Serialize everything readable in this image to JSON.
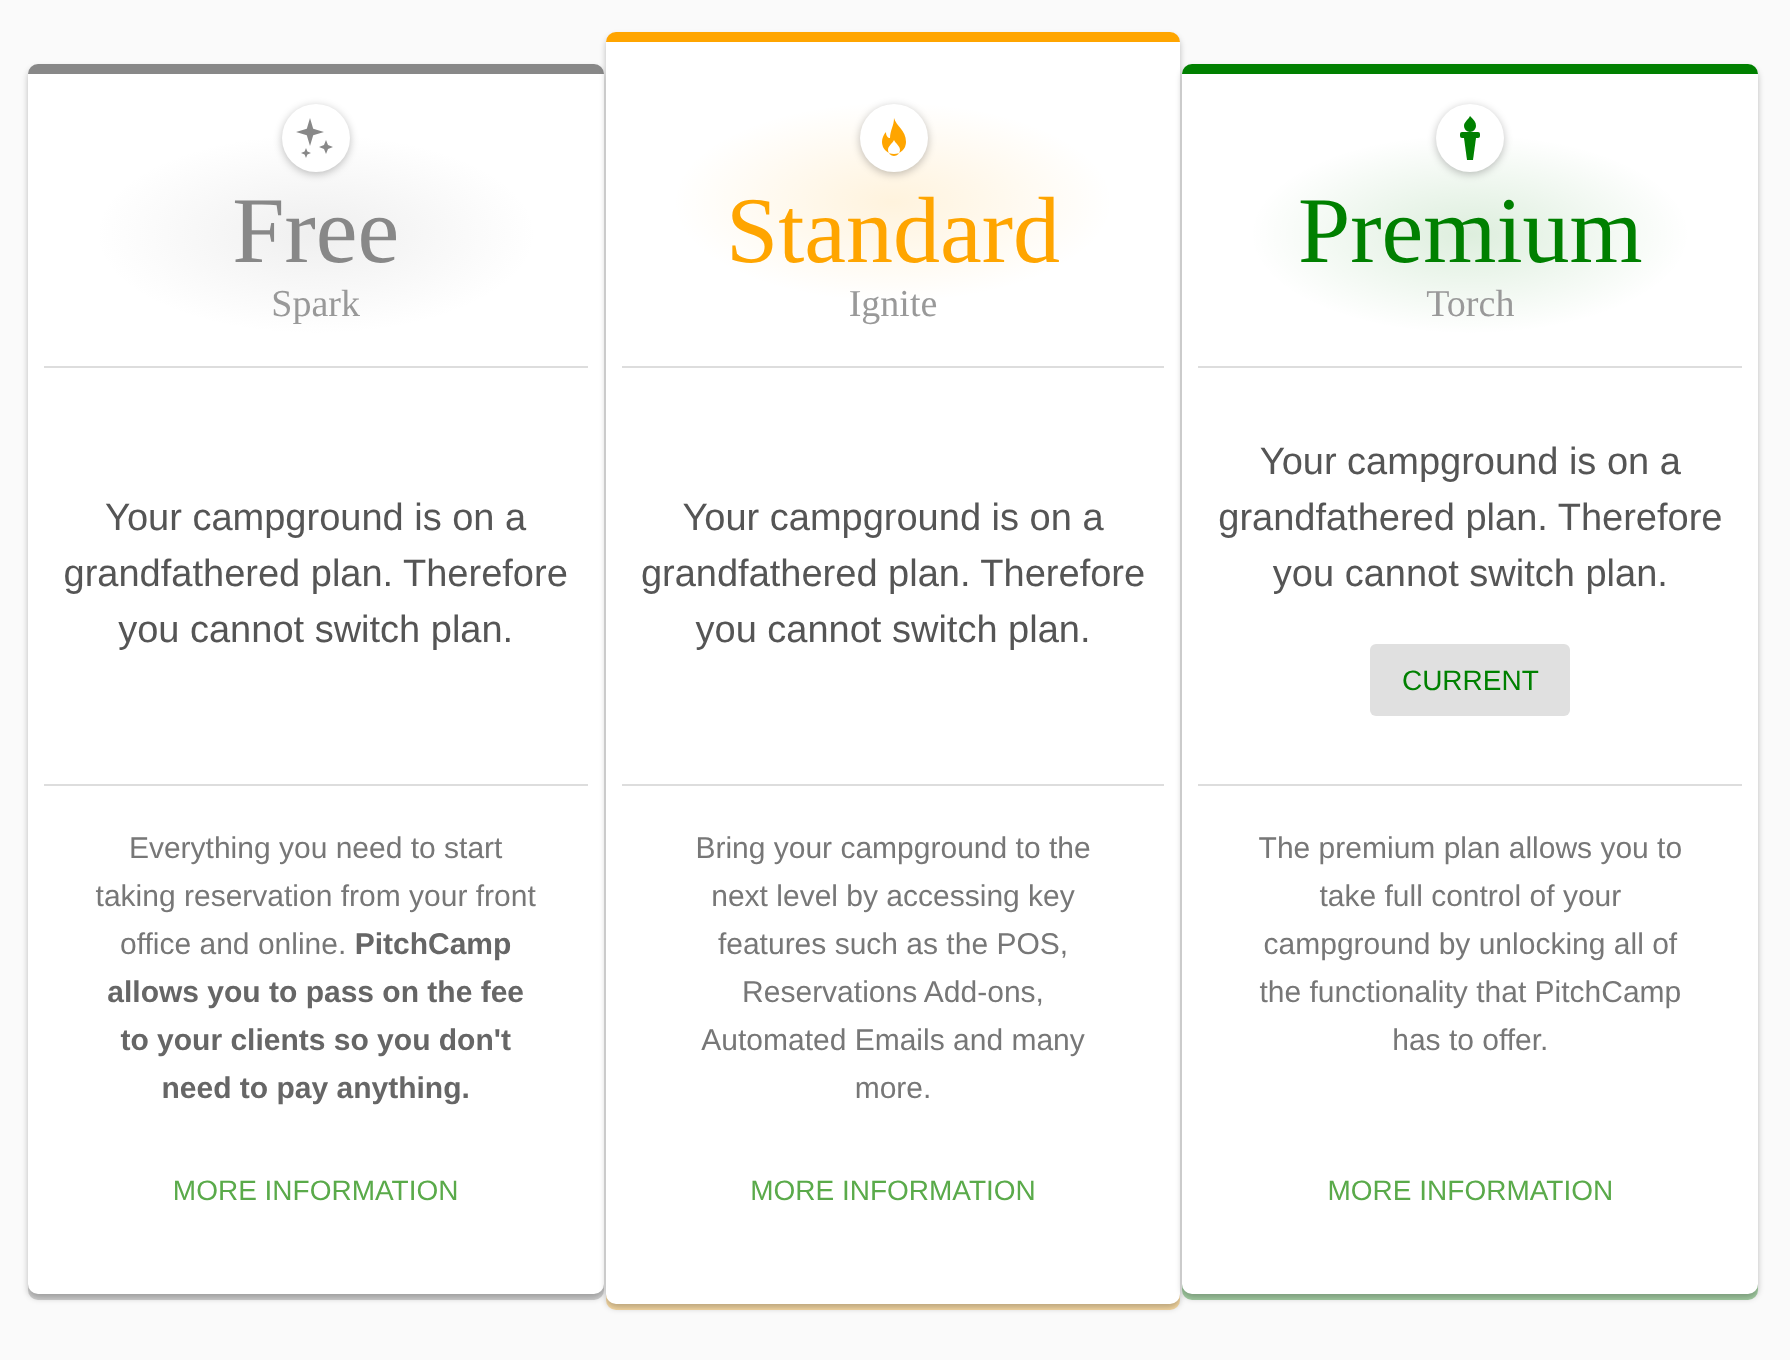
{
  "plans": [
    {
      "kind": "sparkles",
      "color": "#888888",
      "raised": false,
      "title": "Free",
      "subtitle": "Spark",
      "message": "Your campground is on a grandfathered plan. Therefore you cannot switch plan.",
      "description": "Everything you need to start taking reservation from your front office and online. **PitchCamp allows you to pass on the fee to your clients so you don't need to pay anything.**",
      "link": "MORE INFORMATION"
    },
    {
      "kind": "flame",
      "color": "#ffa500",
      "raised": true,
      "title": "Standard",
      "subtitle": "Ignite",
      "message": "Your campground is on a grandfathered plan. Therefore you cannot switch plan.",
      "description": "Bring your campground to the next level by accessing key features such as the POS, Reservations Add-ons, Automated Emails and many more.",
      "link": "MORE INFORMATION"
    },
    {
      "kind": "torch",
      "color": "#008000",
      "raised": false,
      "title": "Premium",
      "subtitle": "Torch",
      "message": "Your campground is on a grandfathered plan. Therefore you cannot switch plan.",
      "button": "CURRENT",
      "description": "The premium plan allows you to take full control of your campground by unlocking all of the functionality that PitchCamp has to offer.",
      "link": "MORE INFORMATION"
    }
  ]
}
